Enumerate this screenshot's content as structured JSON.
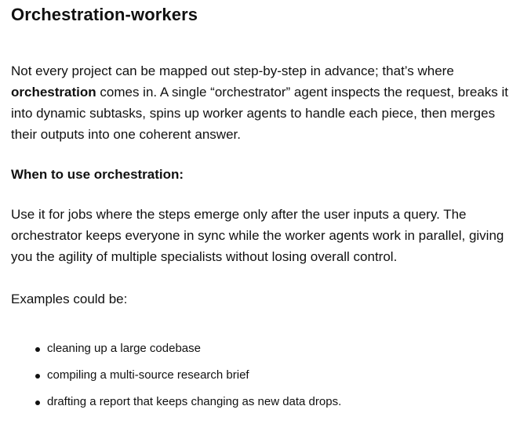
{
  "title": "Orchestration-workers",
  "intro": {
    "lead": "Not every project can be mapped out step-by-step in advance; that’s where",
    "bold": "orchestration",
    "rest": "comes in. A single “orchestrator” agent inspects the request, breaks it into dynamic subtasks, spins up worker agents to handle each piece, then merges their outputs into one coherent answer."
  },
  "when_heading": "When to use orchestration:",
  "when_text": "Use it for jobs where the steps emerge only after the user inputs a query. The orchestrator keeps everyone in sync while the worker agents work in parallel, giving you the agility of multiple specialists without losing overall control.",
  "examples_intro": "Examples could be:",
  "examples": [
    "cleaning up a large codebase",
    "compiling a multi-source research brief",
    "drafting a report that keeps changing as new data drops."
  ]
}
